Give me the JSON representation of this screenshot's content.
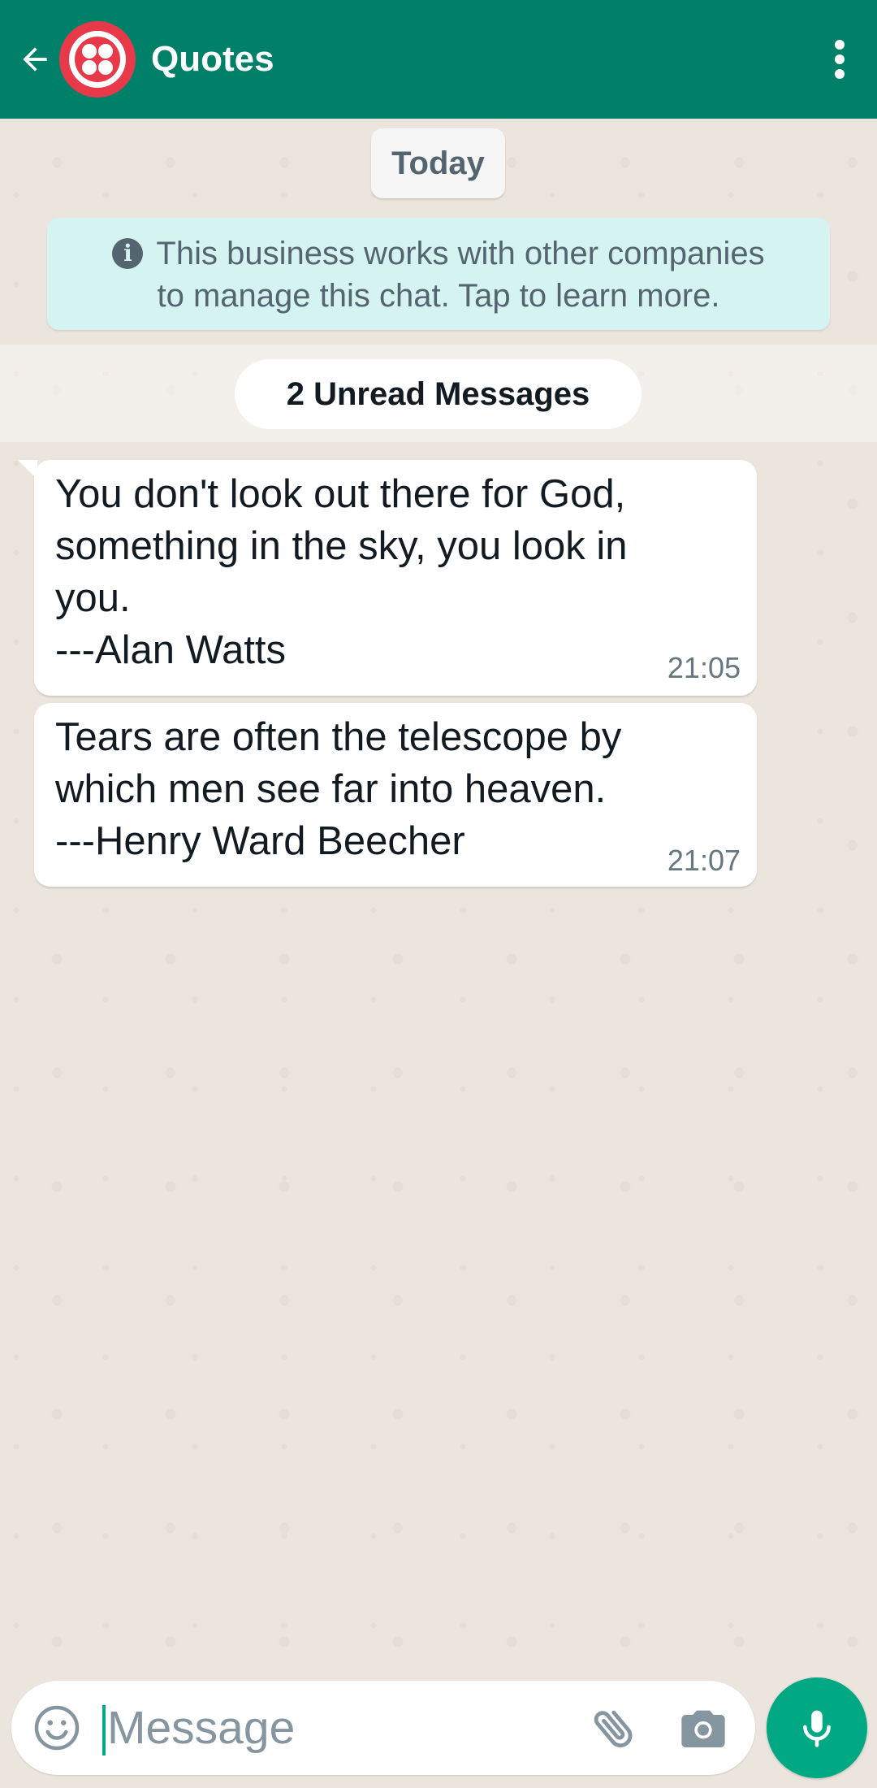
{
  "header": {
    "title": "Quotes",
    "back_icon": "arrow-left-icon",
    "menu_icon": "more-vertical-icon"
  },
  "chat": {
    "date_label": "Today",
    "info_banner": {
      "line1": "This business works with other companies",
      "line2": "to manage this chat. Tap to learn more.",
      "icon": "info-icon"
    },
    "unread_label": "2 Unread Messages",
    "messages": [
      {
        "text": "You don't look out there for God,\nsomething in the sky, you look in\nyou.\n---Alan Watts",
        "time": "21:05"
      },
      {
        "text": "Tears are often the telescope by\nwhich men see far into heaven.\n---Henry Ward Beecher",
        "time": "21:07"
      }
    ]
  },
  "composer": {
    "placeholder": "Message",
    "value": "",
    "emoji_icon": "emoji-icon",
    "attach_icon": "paperclip-icon",
    "camera_icon": "camera-icon",
    "mic_icon": "microphone-icon"
  },
  "colors": {
    "header": "#008069",
    "background": "#ece5dd",
    "accent": "#00a884",
    "info_banner": "#d5f3f1"
  }
}
